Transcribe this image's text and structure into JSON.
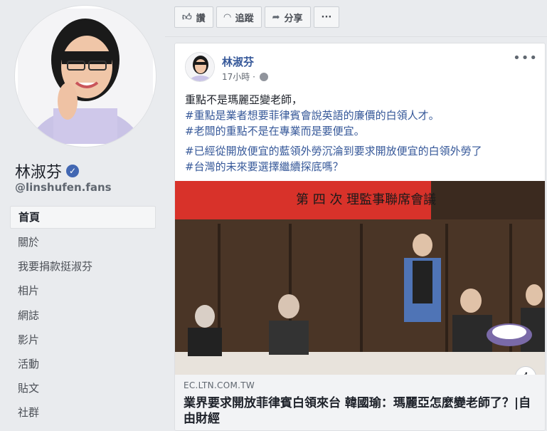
{
  "page": {
    "name": "林淑芬",
    "handle": "@linshufen.fans"
  },
  "nav": {
    "items": [
      "首頁",
      "關於",
      "我要捐款挺淑芬",
      "相片",
      "網誌",
      "影片",
      "活動",
      "貼文",
      "社群"
    ]
  },
  "actions": {
    "like_label": "讚",
    "follow_label": "追蹤",
    "share_label": "分享",
    "more_label": "···"
  },
  "post": {
    "author": "林淑芬",
    "time": "17小時 ·",
    "lines": [
      "重點不是瑪麗亞變老師，",
      "#重點是業者想要菲律賓會說英語的廉價的白領人才。",
      "#老闆的重點不是在專業而是要便宜。",
      "#已經從開放便宜的藍領外勞沉淪到要求開放便宜的白領外勞了",
      "#台灣的未來要選擇繼續探底嗎？"
    ],
    "link": {
      "domain": "EC.LTN.COM.TW",
      "title": "業界要求開放菲律賓白領來台 韓國瑜：瑪麗亞怎麼變老師了？|自由財經",
      "banner_text": "第 四 次 理監事聯席會議"
    }
  },
  "colors": {
    "link_blue": "#365899",
    "verified": "#4267b2",
    "background": "#e9ebee"
  }
}
